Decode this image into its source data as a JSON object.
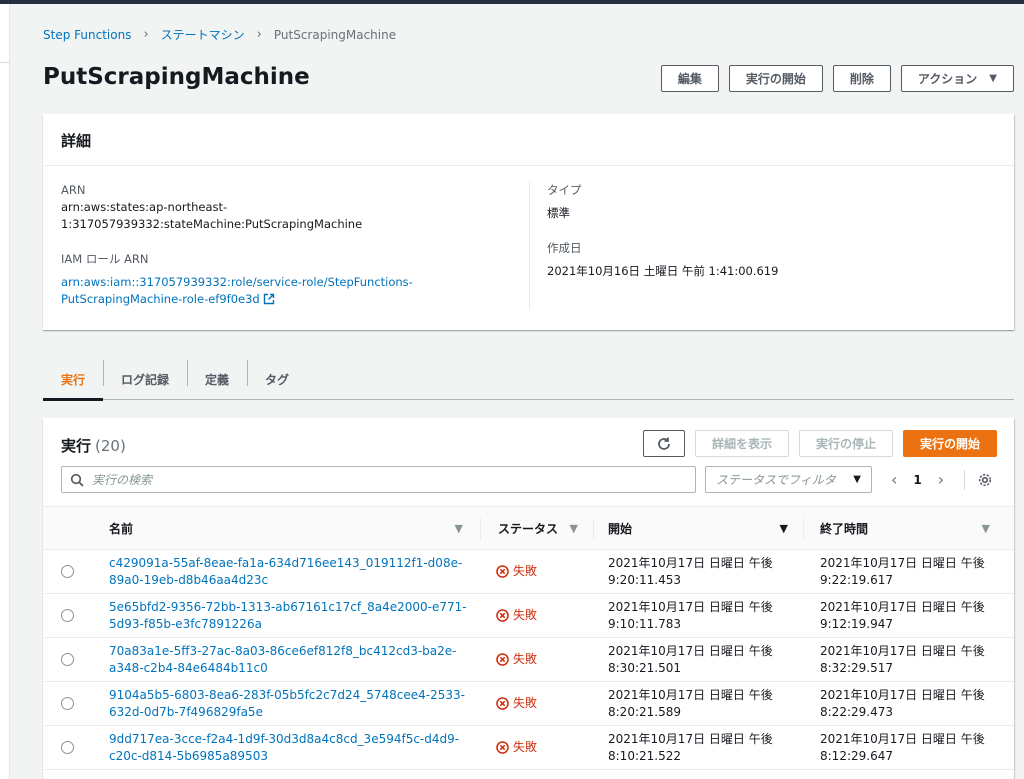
{
  "breadcrumb": {
    "root": "Step Functions",
    "parent": "ステートマシン",
    "current": "PutScrapingMachine"
  },
  "page": {
    "title": "PutScrapingMachine"
  },
  "header_buttons": {
    "edit": "編集",
    "start": "実行の開始",
    "delete": "削除",
    "actions": "アクション"
  },
  "details": {
    "heading": "詳細",
    "arn_label": "ARN",
    "arn_line1": "arn:aws:states:ap-northeast-",
    "arn_line2": "1:317057939332:stateMachine:PutScrapingMachine",
    "iam_label": "IAM ロール ARN",
    "iam_line1": "arn:aws:iam::317057939332:role/service-role/StepFunctions-",
    "iam_line2": "PutScrapingMachine-role-ef9f0e3d",
    "type_label": "タイプ",
    "type_value": "標準",
    "created_label": "作成日",
    "created_value": "2021年10月16日 土曜日 午前 1:41:00.619"
  },
  "tabs": [
    {
      "label": "実行"
    },
    {
      "label": "ログ記録"
    },
    {
      "label": "定義"
    },
    {
      "label": "タグ"
    }
  ],
  "executions": {
    "title": "実行",
    "count": "(20)",
    "view_details": "詳細を表示",
    "stop": "実行の停止",
    "start": "実行の開始",
    "search_placeholder": "実行の検索",
    "status_filter_placeholder": "ステータスでフィルタ",
    "page": "1",
    "columns": {
      "name": "名前",
      "status": "ステータス",
      "start": "開始",
      "end": "終了時間"
    },
    "rows": [
      {
        "name1": "c429091a-55af-8eae-fa1a-634d716ee143_019112f1-d08e-",
        "name2": "89a0-19eb-d8b46aa4d23c",
        "status": "失敗",
        "start1": "2021年10月17日 日曜日 午後",
        "start2": "9:20:11.453",
        "end1": "2021年10月17日 日曜日 午後",
        "end2": "9:22:19.617"
      },
      {
        "name1": "5e65bfd2-9356-72bb-1313-ab67161c17cf_8a4e2000-e771-",
        "name2": "5d93-f85b-e3fc7891226a",
        "status": "失敗",
        "start1": "2021年10月17日 日曜日 午後",
        "start2": "9:10:11.783",
        "end1": "2021年10月17日 日曜日 午後",
        "end2": "9:12:19.947"
      },
      {
        "name1": "70a83a1e-5ff3-27ac-8a03-86ce6ef812f8_bc412cd3-ba2e-",
        "name2": "a348-c2b4-84e6484b11c0",
        "status": "失敗",
        "start1": "2021年10月17日 日曜日 午後",
        "start2": "8:30:21.501",
        "end1": "2021年10月17日 日曜日 午後",
        "end2": "8:32:29.517"
      },
      {
        "name1": "9104a5b5-6803-8ea6-283f-05b5fc2c7d24_5748cee4-2533-",
        "name2": "632d-0d7b-7f496829fa5e",
        "status": "失敗",
        "start1": "2021年10月17日 日曜日 午後",
        "start2": "8:20:21.589",
        "end1": "2021年10月17日 日曜日 午後",
        "end2": "8:22:29.473"
      },
      {
        "name1": "9dd717ea-3cce-f2a4-1d9f-30d3d8a4c8cd_3e594f5c-d4d9-",
        "name2": "c20c-d814-5b6985a89503",
        "status": "失敗",
        "start1": "2021年10月17日 日曜日 午後",
        "start2": "8:10:21.522",
        "end1": "2021年10月17日 日曜日 午後",
        "end2": "8:12:29.647"
      }
    ]
  },
  "colors": {
    "link": "#0073bb",
    "primary": "#ec7211",
    "error": "#d13212",
    "text": "#16191f"
  },
  "icons": {
    "refresh": "refresh-icon",
    "search": "search-icon",
    "settings": "gear-icon",
    "external": "external-link-icon",
    "failed": "x-circle-icon"
  }
}
